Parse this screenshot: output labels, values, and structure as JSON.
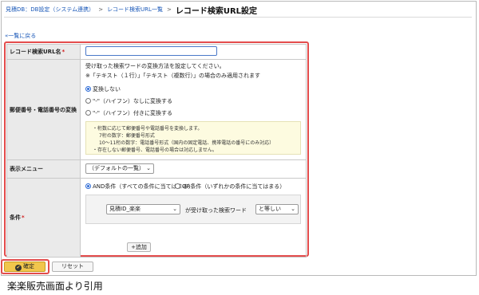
{
  "breadcrumb": {
    "items": [
      "見積DB：DB設定（システム連携）",
      "レコード検索URL一覧"
    ],
    "separator": ">",
    "current": "レコード検索URL設定"
  },
  "back_link": "«一覧に戻る",
  "form": {
    "name_field": {
      "label": "レコード検索URL名",
      "required_mark": "*",
      "value": ""
    },
    "conversion": {
      "label": "郵便番号・電話番号の変換",
      "description": "受け取った検索ワードの変換方法を設定してください。",
      "note": "※「テキスト（１行）」「テキスト（複数行）」の場合のみ適用されます",
      "options": [
        "変換しない",
        "\"-\"（ハイフン）なしに変換する",
        "\"-\"（ハイフン）付きに変換する"
      ],
      "selected_index": 0,
      "info_lines": [
        "・桁数に応じて郵便番号や電話番号を変換します。",
        "7桁の数字：郵便番号形式",
        "10～11桁の数字：電話番号形式（国内の固定電話、携帯電話の番号にのみ対応）",
        "・存在しない郵便番号、電話番号の場合は対応しません。"
      ]
    },
    "menu": {
      "label": "表示メニュー",
      "selected": "（デフォルトの一覧）"
    },
    "condition": {
      "label": "条件",
      "required_mark": "*",
      "options": [
        "AND条件（すべての条件に当てはまる）",
        "OR条件（いずれかの条件に当てはまる）"
      ],
      "selected_index": 0,
      "field_select": "見積ID_楽楽",
      "middle_text": "が受け取った検索ワード",
      "operator_select": "と等しい",
      "add_label": "追加",
      "add_prefix": "+"
    }
  },
  "buttons": {
    "confirm": "確定",
    "reset": "リセット"
  },
  "caption": "楽楽販売画面より引用",
  "colors": {
    "link": "#1a58b8",
    "highlight": "#e34c4c",
    "confirm_bg": "#f1c64c"
  }
}
